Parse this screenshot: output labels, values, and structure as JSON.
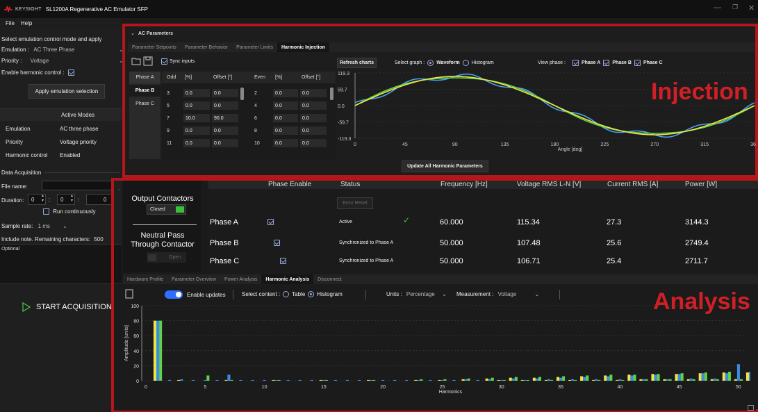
{
  "titlebar": {
    "brand": "KEYSIGHT",
    "app_title": "SL1200A Regenerative AC Emulator SFP"
  },
  "menu": {
    "file": "File",
    "help": "Help"
  },
  "left": {
    "select_mode_text": "Select emulation control mode and apply",
    "emulation_label": "Emulation :",
    "emulation_value": "AC Three Phase",
    "priority_label": "Priority :",
    "priority_value": "Voltage",
    "enable_harmonic_label": "Enable harmonic control :",
    "apply_button": "Apply emulation selection",
    "active_modes_header": "Active Modes",
    "modes": [
      {
        "name": "Emulation",
        "value": "AC three phase"
      },
      {
        "name": "Priority",
        "value": "Voltage priority"
      },
      {
        "name": "Harmonic control",
        "value": "Enabled"
      }
    ],
    "data_acq_label": "Data Acquisition",
    "file_name_label": "File name:",
    "duration_label": "Duration:",
    "duration_h": "0",
    "duration_m": "0",
    "duration_s": "0",
    "run_continuously": "Run continuously",
    "sample_rate_label": "Sample rate:",
    "sample_rate_value": "1 ms",
    "include_note_label": "Include note. Remaining characters:",
    "remaining_chars": "500",
    "note_placeholder": "Optional",
    "start_acq": "START ACQUISITION"
  },
  "ac_params": {
    "section_label": "AC Parameters",
    "tabs": [
      "Parameter Setpoints",
      "Parameter Behavior",
      "Parameter Limits",
      "Harmonic Injection"
    ],
    "sync_inputs": "Sync inputs",
    "phase_tabs": [
      "Phase A",
      "Phase B",
      "Phase C"
    ],
    "odd_headers": [
      "Odd",
      "[%]",
      "Offset [°]"
    ],
    "even_headers": [
      "Even",
      "[%]",
      "Offset [°]"
    ],
    "odd_rows": [
      [
        "3",
        "0.0",
        "0.0"
      ],
      [
        "5",
        "0.0",
        "0.0"
      ],
      [
        "7",
        "10.0",
        "90.0"
      ],
      [
        "9",
        "0.0",
        "0.0"
      ],
      [
        "11",
        "0.0",
        "0.0"
      ]
    ],
    "even_rows": [
      [
        "2",
        "0.0",
        "0.0"
      ],
      [
        "4",
        "0.0",
        "0.0"
      ],
      [
        "6",
        "0.0",
        "0.0"
      ],
      [
        "8",
        "0.0",
        "0.0"
      ],
      [
        "10",
        "0.0",
        "0.0"
      ]
    ],
    "refresh_charts": "Refresh charts",
    "select_graph_label": "Select graph :",
    "waveform": "Waveform",
    "histogram": "Histogram",
    "view_phase_label": "View phase :",
    "phase_a": "Phase A",
    "phase_b": "Phase B",
    "phase_c": "Phase C",
    "update_all": "Update All Harmonic Parameters",
    "injection_label": "Injection"
  },
  "waveform_chart": {
    "y_ticks": [
      "119.3",
      "59.7",
      "0.0",
      "-59.7",
      "-119.3"
    ],
    "x_ticks": [
      "0",
      "45",
      "90",
      "135",
      "180",
      "225",
      "270",
      "315",
      "360"
    ],
    "xlabel": "Angle [deg]"
  },
  "status": {
    "output_contactors": "Output Contactors",
    "closed": "Closed",
    "neutral_pass": "Neutral Pass Through Contactor",
    "open": "Open",
    "headers": [
      "Phase Enable",
      "Status",
      "Frequency [Hz]",
      "Voltage RMS L-N [V]",
      "Current RMS [A]",
      "Power [W]"
    ],
    "error_reset": "Error Reset",
    "rows": [
      {
        "phase": "Phase A",
        "status": "Active",
        "freq": "60.000",
        "volt": "115.34",
        "curr": "27.3",
        "power": "3144.3"
      },
      {
        "phase": "Phase B",
        "status": "Synchronized to Phase A",
        "freq": "50.000",
        "volt": "107.48",
        "curr": "25.6",
        "power": "2749.4"
      },
      {
        "phase": "Phase C",
        "status": "Synchronized to Phase A",
        "freq": "50.000",
        "volt": "106.71",
        "curr": "25.4",
        "power": "2711.7"
      }
    ]
  },
  "analysis": {
    "tabs": [
      "Hardware Profile",
      "Parameter Overview",
      "Power Analysis",
      "Harmonic Analysis",
      "Disconnect"
    ],
    "enable_updates": "Enable updates",
    "select_content_label": "Select content :",
    "table": "Table",
    "histogram": "Histogram",
    "units_label": "Units :",
    "units_value": "Percentage",
    "measurement_label": "Measurement :",
    "measurement_value": "Voltage",
    "analysis_label": "Analysis"
  },
  "chart_data": {
    "type": "bar",
    "xlabel": "Harmonics",
    "ylabel": "Amplitude [units]",
    "ylim": [
      0,
      100
    ],
    "xlim": [
      0,
      51
    ],
    "y_ticks": [
      "100",
      "80",
      "60",
      "40",
      "20",
      "0"
    ],
    "x_ticks": [
      "0",
      "5",
      "10",
      "15",
      "20",
      "25",
      "30",
      "35",
      "40",
      "45",
      "50"
    ],
    "colors": {
      "phase_a": "#f0e445",
      "phase_b": "#3a8ce8",
      "phase_c": "#5fd14a"
    },
    "series": [
      {
        "values": [
          80,
          0,
          1,
          0,
          0,
          0,
          1,
          0,
          0,
          0,
          1,
          0,
          0,
          0,
          1,
          0,
          0,
          0,
          1,
          0,
          0,
          0,
          1,
          0,
          1,
          0,
          2,
          0,
          3,
          1,
          4,
          1,
          4,
          1,
          5,
          1,
          6,
          1,
          7,
          1,
          8,
          2,
          9,
          2,
          9,
          2,
          10,
          2,
          11,
          2,
          11
        ]
      },
      {
        "values": [
          80,
          1,
          2,
          1,
          1,
          1,
          8,
          1,
          1,
          1,
          1,
          1,
          1,
          1,
          1,
          1,
          1,
          1,
          1,
          1,
          1,
          1,
          1,
          1,
          1,
          1,
          2,
          1,
          2,
          1,
          3,
          1,
          3,
          2,
          4,
          2,
          5,
          2,
          6,
          2,
          7,
          2,
          8,
          2,
          9,
          3,
          10,
          3,
          10,
          22,
          12
        ]
      },
      {
        "values": [
          80,
          0,
          0,
          0,
          7,
          0,
          1,
          0,
          0,
          0,
          1,
          0,
          0,
          0,
          1,
          0,
          0,
          0,
          1,
          0,
          0,
          0,
          2,
          0,
          2,
          0,
          3,
          0,
          4,
          1,
          5,
          1,
          5,
          1,
          6,
          1,
          7,
          1,
          8,
          1,
          8,
          2,
          9,
          2,
          10,
          2,
          11,
          2,
          12,
          2,
          13
        ]
      }
    ]
  }
}
